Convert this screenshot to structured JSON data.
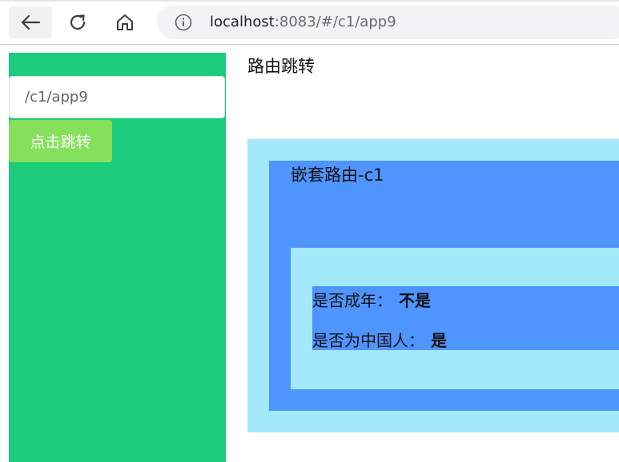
{
  "browser": {
    "url_host": "localhost",
    "url_rest": ":8083/#/c1/app9",
    "icons": [
      "back-arrow-icon",
      "reload-icon",
      "home-icon",
      "info-icon"
    ]
  },
  "sidebar": {
    "route_input_value": "/c1/app9",
    "jump_button_label": "点击跳转",
    "background_color": "#1ccc7a",
    "button_color": "#85e05b"
  },
  "main": {
    "title": "路由跳转",
    "nested": {
      "title": "嵌套路由-c1",
      "adult_label": "是否成年：",
      "adult_value": "不是",
      "chinese_label": "是否为中国人：",
      "chinese_value": "是"
    },
    "colors": {
      "light_blue": "#a4e9fb",
      "blue": "#4f95ff"
    }
  }
}
